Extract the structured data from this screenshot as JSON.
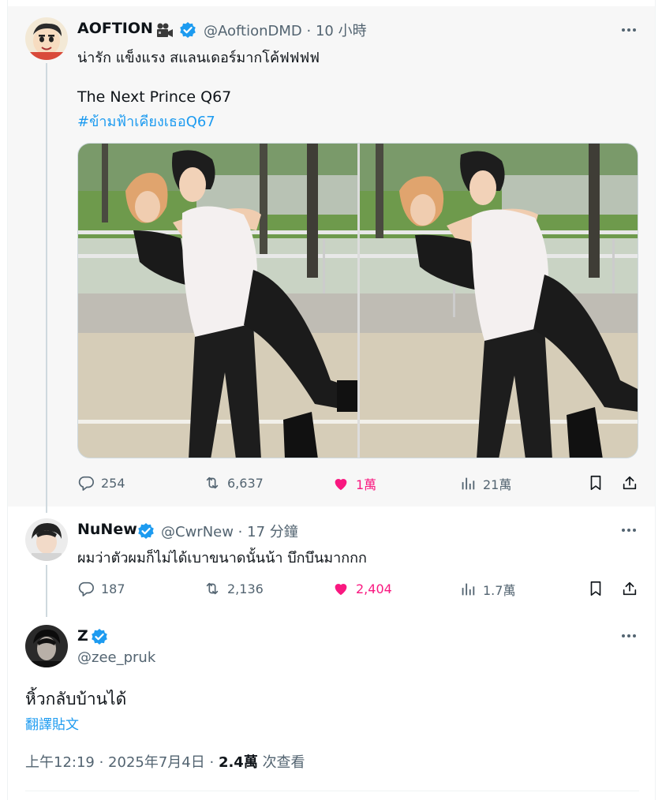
{
  "post1": {
    "display_name": "AOFTION",
    "camera_icon": "movie-camera-icon",
    "handle": "@AoftionDMD",
    "time": "10 小時",
    "line1": "น่ารัก แข็งแรง สแลนเดอร์มากโค้ฟฟฟฟ",
    "line2": "The Next Prince Q67",
    "hashtag": "#ข้ามฟ้าเคียงเธอQ67",
    "replies": "254",
    "reposts": "6,637",
    "likes": "1萬",
    "views": "21萬"
  },
  "post2": {
    "display_name": "NuNew",
    "handle": "@CwrNew",
    "time": "17 分鐘",
    "text": "ผมว่าตัวผมก็ไม่ได้เบาขนาดนั้นน้า บึกบึนมากกก",
    "replies": "187",
    "reposts": "2,136",
    "likes": "2,404",
    "views": "1.7萬"
  },
  "main_post": {
    "display_name": "Z",
    "handle": "@zee_pruk",
    "text": "หิ้วกลับบ้านได้",
    "translate": "翻譯貼文",
    "time": "上午12:19",
    "date": "2025年7月4日",
    "views_count": "2.4萬",
    "views_label": "次查看"
  },
  "colors": {
    "accent": "#1d9bf0",
    "like": "#f91880",
    "muted": "#536471",
    "text": "#0f1419"
  }
}
